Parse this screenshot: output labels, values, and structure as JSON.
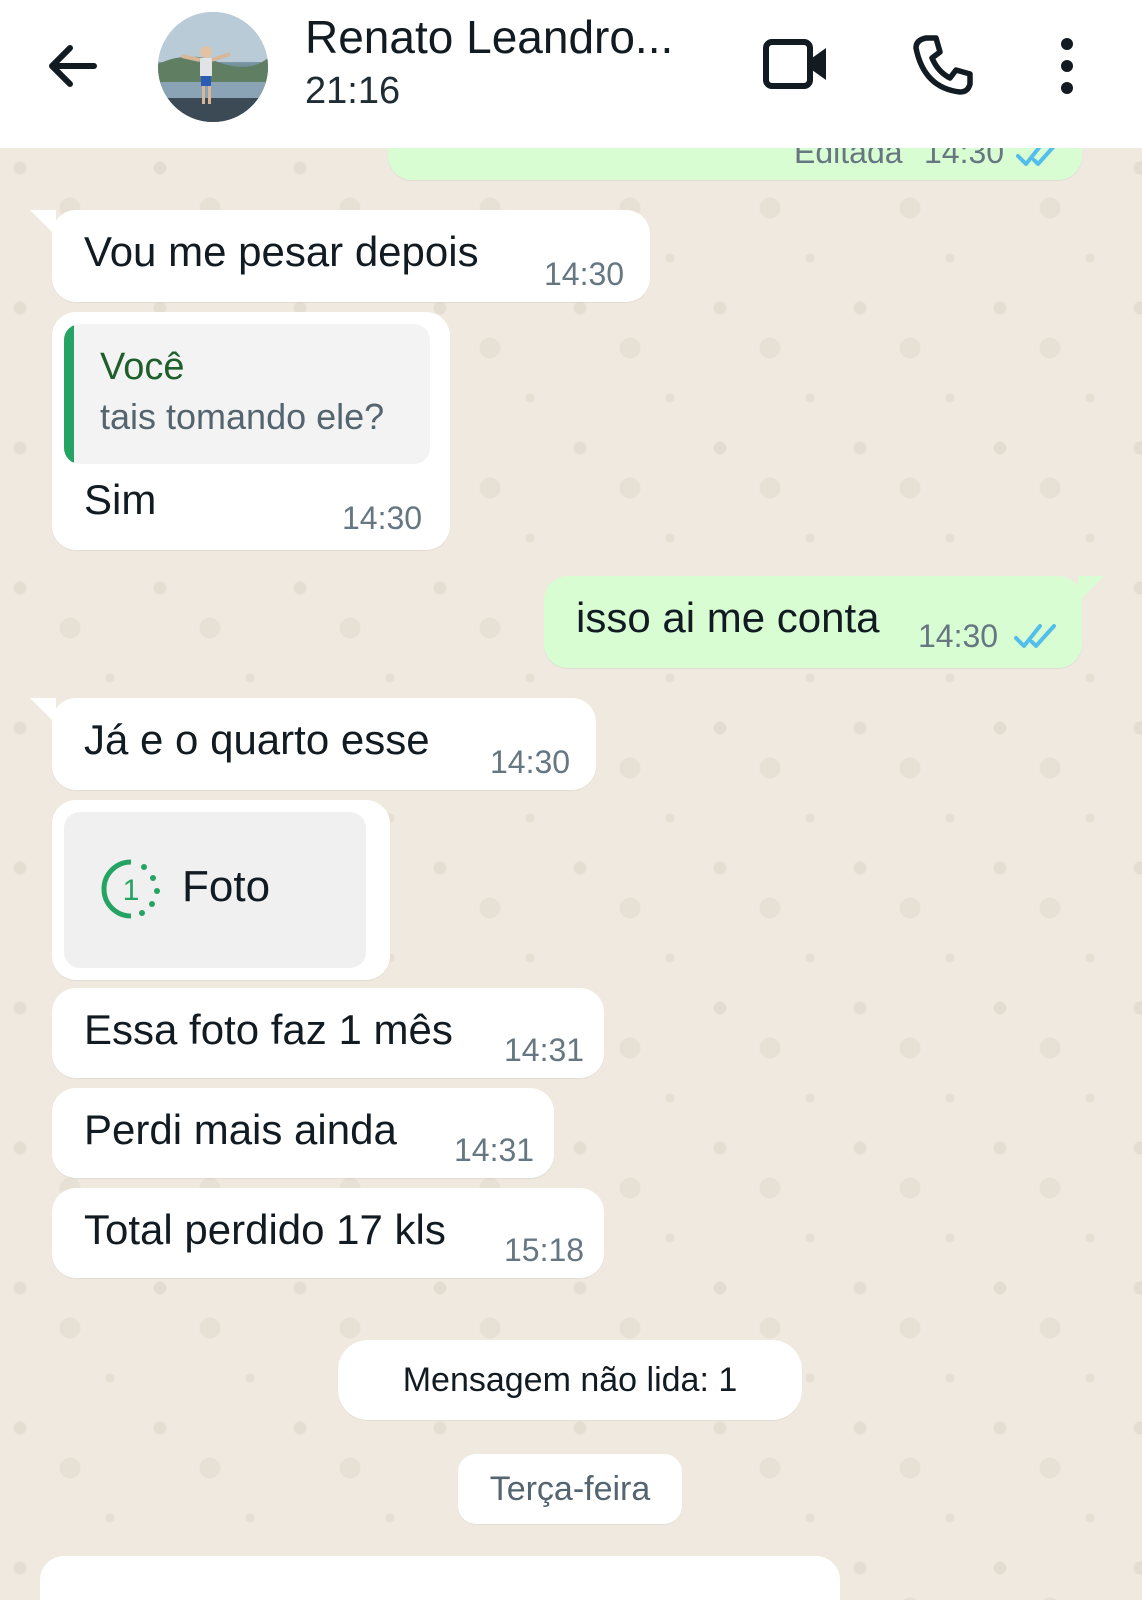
{
  "header": {
    "contact_name": "Renato Leandro...",
    "status": "21:16"
  },
  "messages": {
    "m0": {
      "label": "Editada",
      "time": "14:30"
    },
    "m1": {
      "text": "Vou me pesar depois",
      "time": "14:30"
    },
    "m2": {
      "quote_author": "Você",
      "quote_text": "tais tomando ele?",
      "text": "Sim",
      "time": "14:30"
    },
    "m3": {
      "text": "isso ai me conta",
      "time": "14:30"
    },
    "m4": {
      "text": "Já e o quarto esse",
      "time": "14:30"
    },
    "m5": {
      "label": "Foto",
      "view_once_count": "1"
    },
    "m6": {
      "text": "Essa foto faz 1 mês",
      "time": "14:31"
    },
    "m7": {
      "text": "Perdi mais ainda",
      "time": "14:31"
    },
    "m8": {
      "text": "Total perdido 17 kls",
      "time": "15:18"
    }
  },
  "unread_banner": "Mensagem não lida: 1",
  "date_chip": "Terça-feira",
  "colors": {
    "outgoing_bubble": "#d9fdd3",
    "incoming_bubble": "#ffffff",
    "read_ticks": "#53bdeb",
    "quote_accent": "#25a362"
  }
}
